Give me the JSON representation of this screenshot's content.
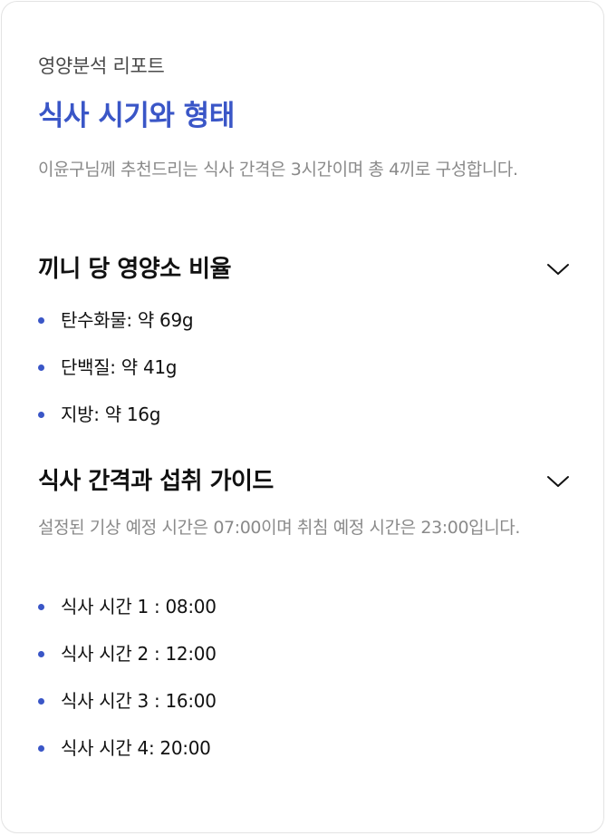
{
  "report": {
    "subtitle": "영양분석 리포트",
    "title": "식사 시기와 형태",
    "description": "이윤구님께 추천드리는 식사 간격은 3시간이며 총 4끼로 구성합니다."
  },
  "sections": [
    {
      "title": "끼니 당 영양소 비율",
      "expanded": true,
      "items": [
        "탄수화물: 약 69g",
        "단백질: 약 41g",
        "지방: 약 16g"
      ]
    },
    {
      "title": "식사 간격과 섭취 가이드",
      "expanded": true,
      "description": "설정된 기상 예정 시간은 07:00이며 취침 예정 시간은 23:00입니다.",
      "items": [
        "식사 시간 1 : 08:00",
        "식사 시간 2 : 12:00",
        "식사 시간 3 : 16:00",
        "식사 시간 4: 20:00"
      ]
    }
  ],
  "icons": {
    "section_toggle": "chevron-down-icon",
    "list_bullet": "bullet-dot"
  },
  "colors": {
    "accent": "#3a56c7",
    "text_primary": "#111111",
    "text_secondary": "#8a8a8a",
    "border": "#e3e3e3"
  }
}
